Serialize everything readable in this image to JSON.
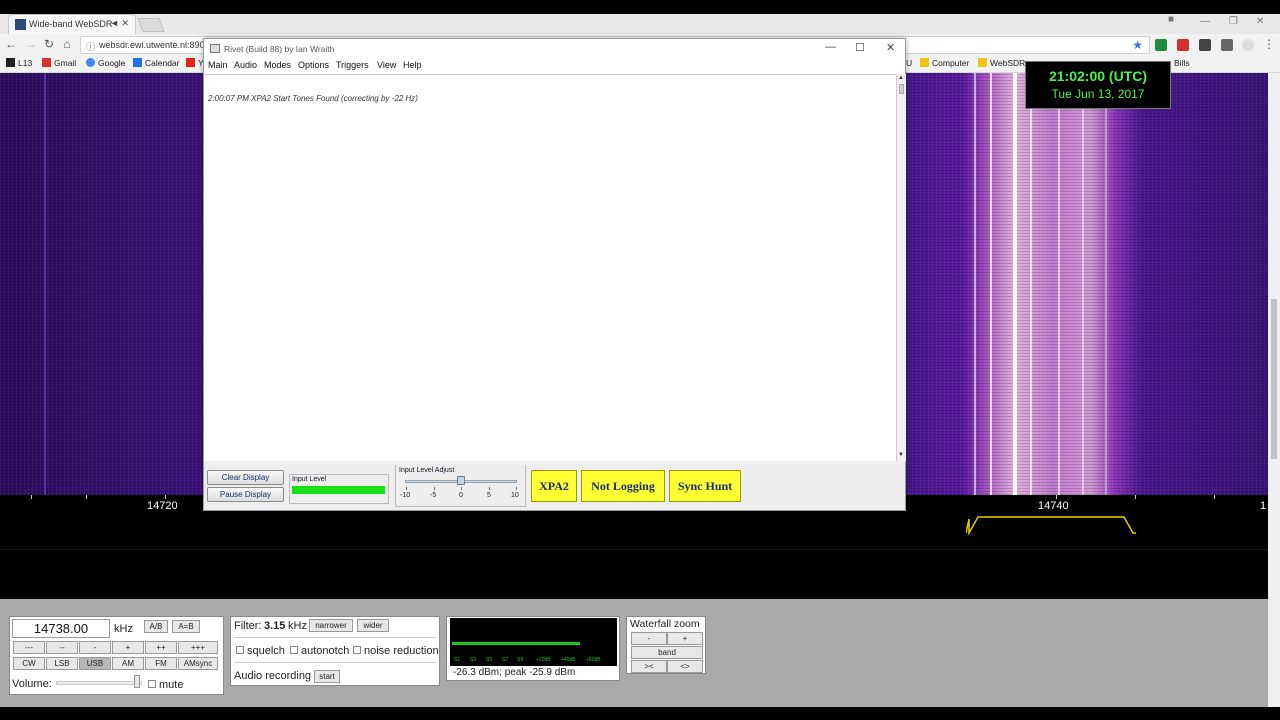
{
  "browser": {
    "tab_title": "Wide-band WebSDR",
    "tab_controls": "◄ ✕",
    "url": "websdr.ewi.utwente.nl:890",
    "bookmarks": [
      {
        "label": "L13",
        "color": "#222222"
      },
      {
        "label": "Gmail",
        "color": "#d93025"
      },
      {
        "label": "Google",
        "color": "#4285f4"
      },
      {
        "label": "Calendar",
        "color": "#1a73e8"
      },
      {
        "label": "Y",
        "color": "#e62117"
      },
      {
        "label": "U",
        "color": "#f2c318"
      },
      {
        "label": "Computer",
        "color": "#f2c318"
      },
      {
        "label": "WebSDR",
        "color": "#f2c318"
      },
      {
        "label": "Bills",
        "color": "#f2c318"
      }
    ]
  },
  "clock": {
    "time": "21:02:00 (UTC)",
    "date": "Tue Jun 13, 2017"
  },
  "scale": {
    "labels": [
      "14720",
      "14740",
      "1"
    ]
  },
  "rivet": {
    "title": "Rivet (Build 88) by Ian Wraith",
    "menu": [
      "Main",
      "Audio",
      "Modes",
      "Options",
      "Triggers",
      "View",
      "Help"
    ],
    "log_message": "2:00:07 PM XPA2 Start Tones Found (correcting by -22 Hz)",
    "clear_label": "Clear Display",
    "pause_label": "Pause Display",
    "input_level_label": "Input Level",
    "input_level_fraction": 0.98,
    "adjust_label": "Input Level Adjust",
    "adjust_ticks": [
      "-10",
      "-5",
      "0",
      "5",
      "10"
    ],
    "adjust_value": 0,
    "mode_button": "XPA2",
    "logging_button": "Not Logging",
    "sync_button": "Sync Hunt"
  },
  "websdr": {
    "frequency": "14738.00",
    "unit": "kHz",
    "ab_label": "A/B",
    "aeqb_label": "A=B",
    "step_buttons_row1": [
      "---",
      "--",
      "-",
      "+",
      "++",
      "+++"
    ],
    "modes": [
      "CW",
      "LSB",
      "USB",
      "AM",
      "FM",
      "AMsync"
    ],
    "active_mode": "USB",
    "volume_label": "Volume:",
    "mute_label": "mute",
    "filter_label": "Filter:",
    "filter_value": "3.15",
    "filter_unit": "kHz",
    "narrower_label": "narrower",
    "wider_label": "wider",
    "squelch_label": "squelch",
    "autonotch_label": "autonotch",
    "noise_label": "noise reduction",
    "audio_rec_label": "Audio recording",
    "start_label": "start",
    "smeter_labels": [
      "S1",
      "S3",
      "S5",
      "S7",
      "S9",
      "+20dB",
      "+40dB",
      "+60dB"
    ],
    "smeter_reading": "-26.3 dBm; peak  -25.9 dBm",
    "wf_zoom_label": "Waterfall zoom",
    "zoom_minus": "-",
    "zoom_plus": "+",
    "band_label": "band",
    "zoom_in": "><",
    "zoom_out": "<>"
  }
}
